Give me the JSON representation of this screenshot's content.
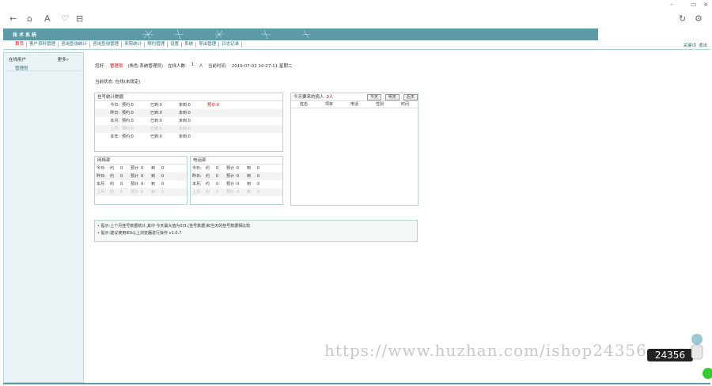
{
  "window": {
    "min": "–",
    "max": "▭",
    "close": "×"
  },
  "toolbar": {
    "back": "←",
    "home": "⌂",
    "reader": "A",
    "like": "♡",
    "tabs": "⊟",
    "refresh": "↻",
    "settings": "⚙"
  },
  "app": {
    "title": "技术系统"
  },
  "nav": {
    "items": [
      "首页",
      "客户资料管理",
      "咨询查询统计",
      "咨询查询管理",
      "来院统计",
      "预约管理",
      "设置",
      "系统",
      "导出管理",
      "日志记录"
    ],
    "right": [
      "关键词",
      "退出"
    ]
  },
  "sidebar": {
    "heading": "在线用户",
    "more": "更多»",
    "user": "管理员"
  },
  "info": {
    "welcome": "您好:",
    "user": "管理员",
    "role": "(角色:系统管理员)",
    "online": "在线人数:",
    "online_count": "1",
    "unit": "人",
    "time_label": "当前时间:",
    "time": "2019-07-02 10:27:11 星期二"
  },
  "status": "当前状态: 在线(未锁定)",
  "stats": {
    "title": "挂号统计数据",
    "rows": [
      {
        "label": "今日:",
        "a": "预约:0",
        "b": "已到:0",
        "c": "未到:0",
        "d": "预诊:0",
        "faded": false
      },
      {
        "label": "昨日:",
        "a": "预约:0",
        "b": "已到:0",
        "c": "未到:0",
        "d": "",
        "faded": false
      },
      {
        "label": "本月:",
        "a": "预约:0",
        "b": "已到:0",
        "c": "未到:0",
        "d": "",
        "faded": false
      },
      {
        "label": "上月:",
        "a": "预约:0",
        "b": "已到:0",
        "c": "未到:0",
        "d": "",
        "faded": true
      },
      {
        "label": "本年:",
        "a": "预约:0",
        "b": "已到:0",
        "c": "未到:0",
        "d": "",
        "faded": false
      }
    ]
  },
  "net": {
    "title": "网络部",
    "rows": [
      {
        "label": "今日:",
        "v": [
          "约",
          "0",
          "预计",
          "0",
          "到",
          "0"
        ],
        "faded": false
      },
      {
        "label": "昨日:",
        "v": [
          "约",
          "0",
          "预计",
          "0",
          "到",
          "0"
        ],
        "faded": false
      },
      {
        "label": "本月:",
        "v": [
          "约",
          "0",
          "预计",
          "0",
          "到",
          "0"
        ],
        "faded": false
      },
      {
        "label": "上月:",
        "v": [
          "约",
          "0",
          "预计",
          "0",
          "到",
          "0"
        ],
        "faded": true
      }
    ]
  },
  "phone": {
    "title": "电话部",
    "rows": [
      {
        "label": "今日:",
        "v": [
          "约",
          "0",
          "预计",
          "0",
          "到",
          "0"
        ],
        "faded": false
      },
      {
        "label": "昨日:",
        "v": [
          "约",
          "0",
          "预计",
          "0",
          "到",
          "0"
        ],
        "faded": false
      },
      {
        "label": "本月:",
        "v": [
          "约",
          "0",
          "预计",
          "0",
          "到",
          "0"
        ],
        "faded": false
      },
      {
        "label": "上月:",
        "v": [
          "约",
          "0",
          "预计",
          "0",
          "到",
          "0"
        ],
        "faded": true
      }
    ]
  },
  "today": {
    "title": "今天要来的病人",
    "count": "0人",
    "btn_today": "今天",
    "btn_tomorrow": "明天",
    "btn_after": "后天",
    "cols": [
      "姓名",
      "项目",
      "电话",
      "性别",
      "时间"
    ]
  },
  "notice": {
    "line1": "• 提示:上个月挂号数据统计,其中 今天最大值为0日,(挂号数据)和当天的挂号数据相比较",
    "line2": "• 提示:建议使用IE9以上浏览器进行操作 v1.0.7"
  },
  "watermark": "https://www.huzhan.com/ishop24356",
  "badge": "24356"
}
